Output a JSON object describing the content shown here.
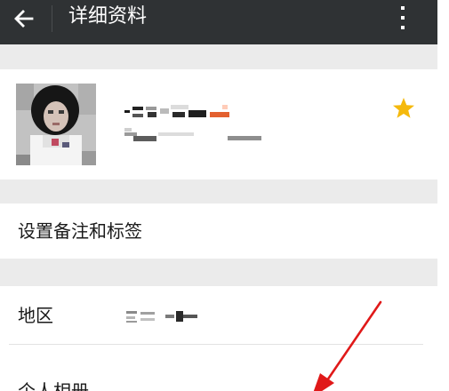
{
  "header": {
    "title": "详细资料",
    "back_icon": "arrow-left-icon",
    "more_icon": "more-vertical-icon"
  },
  "profile": {
    "avatar": "blurred-photo",
    "name": "",
    "account_id": "",
    "star_icon": "star-icon",
    "star_color": "#f5b90c"
  },
  "rows": {
    "remark_tags": "设置备注和标签",
    "region_label": "地区",
    "region_value": "",
    "album_label": "个人相册"
  },
  "annotation_color": "#e01919",
  "colors": {
    "top_bar": "#2f3234",
    "section_gap": "#ebebeb"
  }
}
